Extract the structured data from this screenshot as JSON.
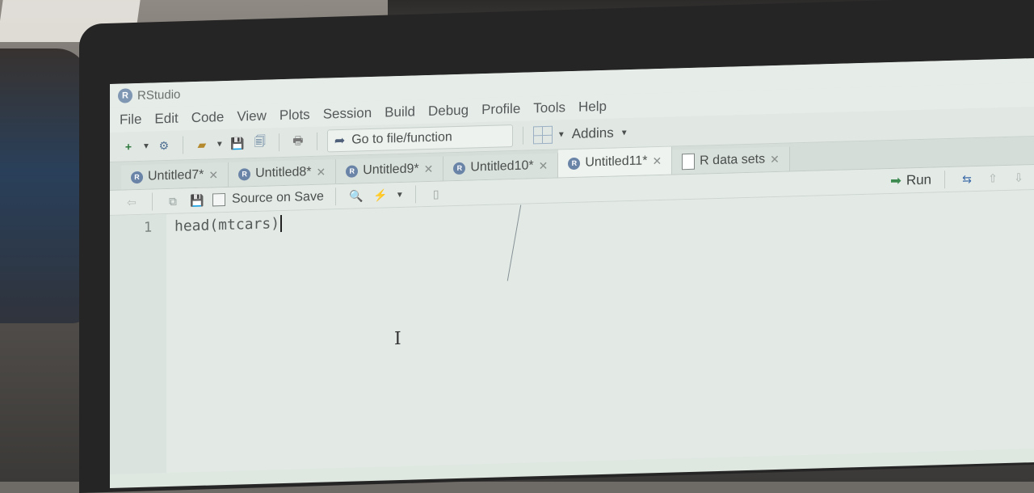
{
  "window": {
    "title": "RStudio",
    "logo_glyph": "R"
  },
  "menu": [
    "File",
    "Edit",
    "Code",
    "View",
    "Plots",
    "Session",
    "Build",
    "Debug",
    "Profile",
    "Tools",
    "Help"
  ],
  "toolbar": {
    "goto_placeholder": "Go to file/function",
    "addins_label": "Addins"
  },
  "tabs": [
    {
      "label": "Untitled7*",
      "icon": "r-file-icon",
      "active": false
    },
    {
      "label": "Untitled8*",
      "icon": "r-file-icon",
      "active": false
    },
    {
      "label": "Untitled9*",
      "icon": "r-file-icon",
      "active": false
    },
    {
      "label": "Untitled10*",
      "icon": "r-file-icon",
      "active": false
    },
    {
      "label": "Untitled11*",
      "icon": "r-file-icon",
      "active": true
    },
    {
      "label": "R data sets",
      "icon": "document-icon",
      "active": false
    }
  ],
  "editor_toolbar": {
    "source_on_save_label": "Source on Save",
    "run_label": "Run"
  },
  "editor": {
    "line_number": "1",
    "code": "head(mtcars)"
  },
  "colors": {
    "screen_bg": "#dfe7e1",
    "accent_blue": "#6a84a8",
    "run_green": "#3c8a4f"
  }
}
